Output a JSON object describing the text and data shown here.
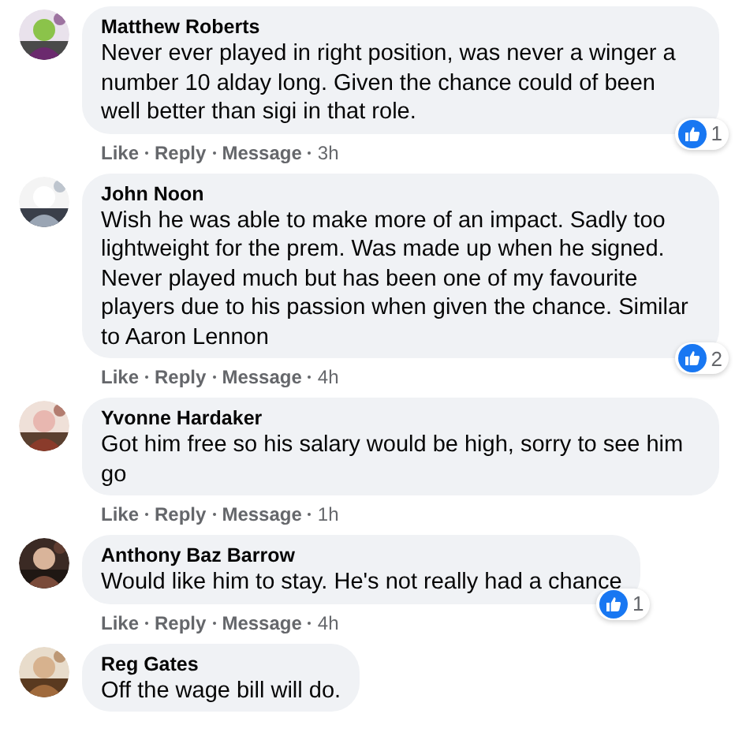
{
  "comments": [
    {
      "author": "Matthew Roberts",
      "text": "Never ever played in right position, was never a winger a number 10 alday long. Given the chance could of been well better than sigi in that role.",
      "actions": [
        "Like",
        "Reply",
        "Message"
      ],
      "time": "3h",
      "reactions": "1"
    },
    {
      "author": "John Noon",
      "text": "Wish he was able to make more of an impact. Sadly too lightweight for the prem. Was made up when he signed. Never played much but has been one of my favourite players due to his passion when given the chance. Similar to Aaron Lennon",
      "actions": [
        "Like",
        "Reply",
        "Message"
      ],
      "time": "4h",
      "reactions": "2"
    },
    {
      "author": "Yvonne Hardaker",
      "text": "Got him free so his salary would be high, sorry to see him go",
      "actions": [
        "Like",
        "Reply",
        "Message"
      ],
      "time": "1h"
    },
    {
      "author": "Anthony Baz Barrow",
      "text": "Would like him to stay. He's not really had a chance",
      "actions": [
        "Like",
        "Reply",
        "Message"
      ],
      "time": "4h",
      "reactions": "1"
    },
    {
      "author": "Reg Gates",
      "text": "Off the wage bill will do."
    }
  ]
}
